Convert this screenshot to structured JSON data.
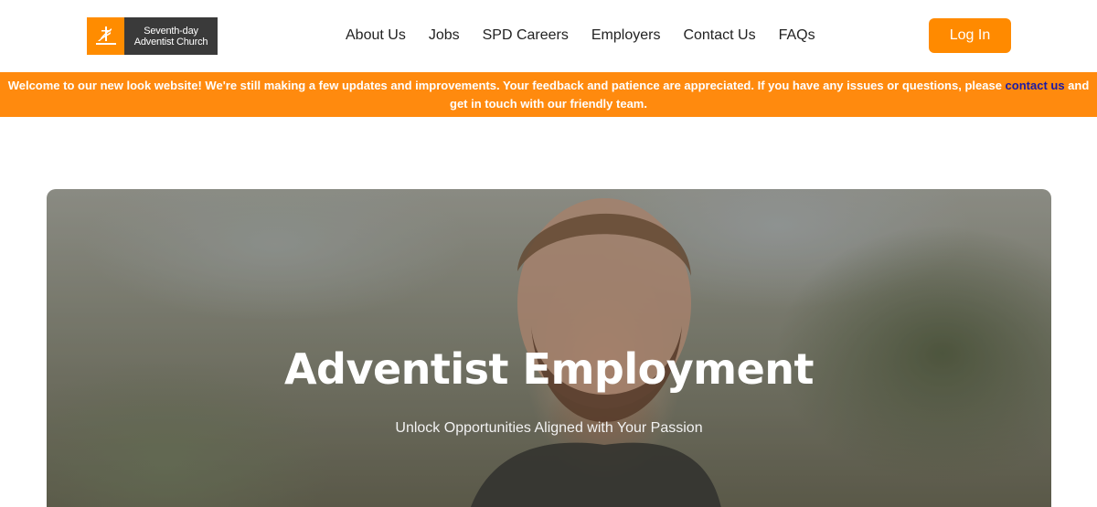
{
  "header": {
    "logo": {
      "line1": "Seventh-day",
      "line2": "Adventist Church",
      "brand_color": "#ff8c00"
    },
    "nav": [
      "About Us",
      "Jobs",
      "SPD Careers",
      "Employers",
      "Contact Us",
      "FAQs"
    ],
    "login_label": "Log In"
  },
  "banner": {
    "text_before": "Welcome to our new look website! We're still making a few updates and improvements. Your feedback and patience are appreciated. If you have any issues or questions, please ",
    "link": "contact us",
    "text_after": " and get in touch with our friendly team.",
    "color": "#ff8a0e"
  },
  "hero": {
    "title": "Adventist Employment",
    "subtitle": "Unlock Opportunities Aligned with Your Passion"
  }
}
